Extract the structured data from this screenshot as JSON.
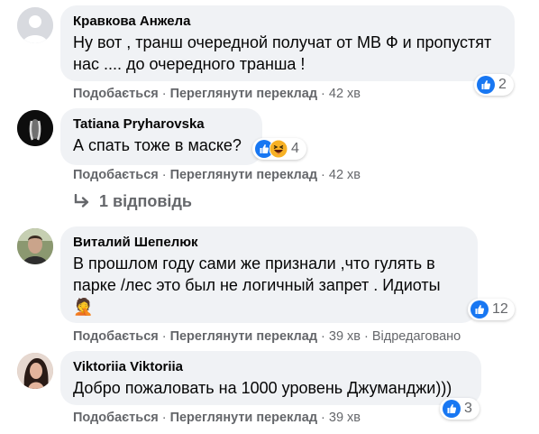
{
  "comments": [
    {
      "author": "Кравкова Анжела",
      "text": "Ну вот , транш очередной получат от МВ Ф и пропустят нас .... до очередного транша !",
      "like_label": "Подобається",
      "translate_label": "Переглянути переклад",
      "time": "42 хв",
      "reaction_count": "2"
    },
    {
      "author": "Tatiana Pryharovska",
      "text": "А спать тоже в маске?",
      "like_label": "Подобається",
      "translate_label": "Переглянути переклад",
      "time": "42 хв",
      "reaction_count": "4"
    },
    {
      "author": "Виталий Шепелюк",
      "text": "В прошлом году сами же признали ,что гулять в парке /лес это был не логичный запрет . Идиоты",
      "emoji": "🤦",
      "like_label": "Подобається",
      "translate_label": "Переглянути переклад",
      "time": "39 хв",
      "edited_label": "Відредаговано",
      "reaction_count": "12"
    },
    {
      "author": "Viktoriia Viktoriia",
      "text": "Добро пожаловать на 1000 уровень Джуманджи)))",
      "like_label": "Подобається",
      "translate_label": "Переглянути переклад",
      "time": "39 хв",
      "reaction_count": "3"
    }
  ],
  "replies_link": "1 відповідь",
  "icons": {
    "reply": "reply-arrow-icon",
    "like": "like-icon",
    "haha": "haha-icon",
    "facepalm": "facepalm-emoji"
  },
  "colors": {
    "like_blue": "#1877f2",
    "bubble_bg": "#f0f2f5",
    "secondary_text": "#65676b",
    "haha_yellow": "#f7b125"
  }
}
